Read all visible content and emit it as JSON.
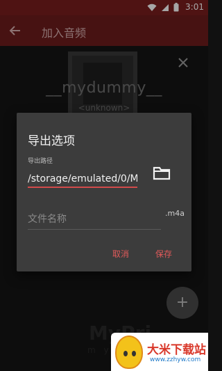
{
  "status_bar": {
    "time": "3:01"
  },
  "app_bar": {
    "title": "加入音频"
  },
  "track": {
    "title": "__mydummy__",
    "subtitle": "<unknown>"
  },
  "background": {
    "watermark": "MyPri",
    "watermark_sub": "m y p"
  },
  "dialog": {
    "title": "导出选项",
    "path_label": "导出路径",
    "path_value": "/storage/emulated/0/M",
    "name_placeholder": "文件名称",
    "extension": ".m4a",
    "cancel_label": "取消",
    "save_label": "保存"
  },
  "fab": {
    "label": "+"
  },
  "logo": {
    "title": "大米下载站",
    "url": "www.zzhyw.com"
  },
  "colors": {
    "status_bar": "#7a1e1e",
    "app_bar": "#6e1c1c",
    "accent": "#e05a5a",
    "dialog_bg": "#3c3c3c"
  }
}
